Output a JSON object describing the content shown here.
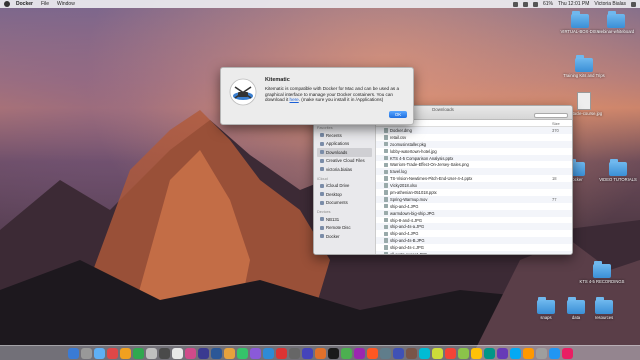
{
  "menubar": {
    "app_name": "Docker",
    "items": [
      "File",
      "Window"
    ],
    "battery": "61%",
    "clock": "Thu 12:01 PM",
    "user": "Victoria Bialas"
  },
  "desktop_icons": [
    {
      "label": "VIRTUAL-BOX-DISK",
      "kind": "folder"
    },
    {
      "label": "webinar-whiteboard",
      "kind": "folder"
    },
    {
      "label": "Training Kits and Trips",
      "kind": "folder"
    },
    {
      "label": "obstacle-course.jpg",
      "kind": "doc"
    },
    {
      "label": "Docker",
      "kind": "folder"
    },
    {
      "label": "VIDEO TUTORIALS",
      "kind": "folder"
    },
    {
      "label": "KTS 4-5 RECORDINGS",
      "kind": "folder"
    },
    {
      "label": "snaps",
      "kind": "folder"
    },
    {
      "label": "data",
      "kind": "folder"
    },
    {
      "label": "resources",
      "kind": "folder"
    }
  ],
  "alert": {
    "title": "Kitematic",
    "message_prefix": "Kitematic is compatible with Docker for Mac and can be used as a graphical interface to manage your Docker containers. You can download it ",
    "link_text": "here",
    "message_suffix": ". (make sure you install it in /Applications)",
    "ok_label": "OK"
  },
  "finder": {
    "title": "Downloads",
    "sidebar": {
      "favorites_header": "Favorites",
      "favorites": [
        "Recents",
        "Applications",
        "Downloads",
        "Creative Cloud Files",
        "victoria.bialas"
      ],
      "selected": "Downloads",
      "icloud_header": "iCloud",
      "icloud": [
        "iCloud Drive",
        "Desktop",
        "Documents"
      ],
      "devices_header": "Devices",
      "devices": [
        "NB131",
        "Remote Disc",
        "Docker"
      ]
    },
    "columns": {
      "name": "Name",
      "size": "Size"
    },
    "files": [
      {
        "name": "Docker.dmg",
        "size": "370"
      },
      {
        "name": "retail.csv",
        "size": ""
      },
      {
        "name": "zoomusinstaller.pkg",
        "size": ""
      },
      {
        "name": "lobby-watertown-hotel.jpg",
        "size": ""
      },
      {
        "name": "KTS 4-5 Comparison Analysis.pptx",
        "size": ""
      },
      {
        "name": "Warriors-Trade-Effect-On-Jersey-Sales.png",
        "size": ""
      },
      {
        "name": "travel.log",
        "size": ""
      },
      {
        "name": "TS-Vision-Newtimes-Pitch-End-User-4-4.pptx",
        "size": "18"
      },
      {
        "name": "Vicky2018.xlsx",
        "size": ""
      },
      {
        "name": "pm-athenian-051018.pptx",
        "size": ""
      },
      {
        "name": "Spring-Warmup.mov",
        "size": "77"
      },
      {
        "name": "ship-and-4.JPG",
        "size": ""
      },
      {
        "name": "warmdown-big-ship.JPG",
        "size": ""
      },
      {
        "name": "ship-8-and-4.JPG",
        "size": ""
      },
      {
        "name": "ship-and-4s-a.JPG",
        "size": ""
      },
      {
        "name": "ship-and-4.JPG",
        "size": ""
      },
      {
        "name": "ship-and-4s-B.JPG",
        "size": ""
      },
      {
        "name": "ship-and-4s-c.JPG",
        "size": ""
      },
      {
        "name": "all-ports-sunset.JPG",
        "size": ""
      }
    ]
  },
  "colors": {
    "dock_bg": "#c9c9d6",
    "accent": "#1f6fe0"
  }
}
